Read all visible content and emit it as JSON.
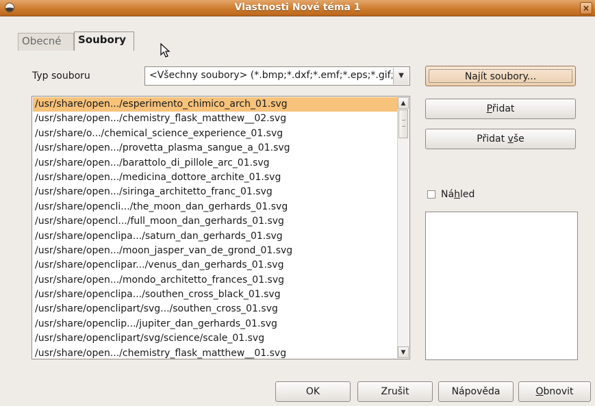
{
  "window": {
    "title": "Vlastnosti Nové téma 1",
    "close_label": "×"
  },
  "tabs": [
    {
      "label": "Obecné",
      "active": false
    },
    {
      "label": "Soubory",
      "active": true
    }
  ],
  "filetype": {
    "label": "Typ souboru",
    "value": "<Všechny soubory> (*.bmp;*.dxf;*.emf;*.eps;*.gif;*.jpg)"
  },
  "buttons": {
    "find": {
      "before": "Na",
      "key": "j",
      "after": "ít soubory..."
    },
    "add": {
      "before": "",
      "key": "P",
      "after": "řidat"
    },
    "add_all": {
      "before": "Přidat ",
      "key": "v",
      "after": "še"
    },
    "ok": "OK",
    "cancel": "Zrušit",
    "help": "Nápověda",
    "reset": {
      "before": "",
      "key": "O",
      "after": "bnovit"
    }
  },
  "preview": {
    "before": "Ná",
    "key": "h",
    "after": "led",
    "checked": false
  },
  "file_list": [
    "/usr/share/open.../esperimento_chimico_arch_01.svg",
    "/usr/share/open.../chemistry_flask_matthew__02.svg",
    "/usr/share/o.../chemical_science_experience_01.svg",
    "/usr/share/open.../provetta_plasma_sangue_a_01.svg",
    "/usr/share/open.../barattolo_di_pillole_arc_01.svg",
    "/usr/share/open.../medicina_dottore_archite_01.svg",
    "/usr/share/open.../siringa_architetto_franc_01.svg",
    "/usr/share/opencli.../the_moon_dan_gerhards_01.svg",
    "/usr/share/opencl.../full_moon_dan_gerhards_01.svg",
    "/usr/share/openclipa.../saturn_dan_gerhards_01.svg",
    "/usr/share/open.../moon_jasper_van_de_grond_01.svg",
    "/usr/share/openclipar.../venus_dan_gerhards_01.svg",
    "/usr/share/open.../mondo_architetto_frances_01.svg",
    "/usr/share/openclipa.../southen_cross_black_01.svg",
    "/usr/share/openclipart/svg.../southen_cross_01.svg",
    "/usr/share/openclip.../jupiter_dan_gerhards_01.svg",
    "/usr/share/openclipart/svg/science/scale_01.svg",
    "/usr/share/open.../chemistry_flask_matthew__01.svg"
  ],
  "selected_index": 0,
  "colors": {
    "titlebar": "#cf7c2f",
    "selection": "#f7c27a",
    "focus_button": "#eccfae"
  }
}
